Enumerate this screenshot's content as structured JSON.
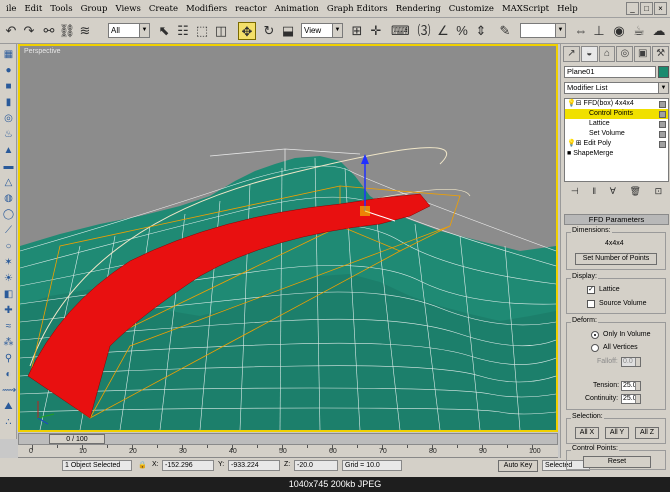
{
  "menu": [
    "ile",
    "Edit",
    "Tools",
    "Group",
    "Views",
    "Create",
    "Modifiers",
    "reactor",
    "Animation",
    "Graph Editors",
    "Rendering",
    "Customize",
    "MAXScript",
    "Help"
  ],
  "window_controls": [
    "_",
    "□",
    "×"
  ],
  "toolbar": {
    "selection_filter": "All",
    "reference_coord": "View"
  },
  "viewport": {
    "label": "Perspective",
    "colors": {
      "background": "#8c8c8c",
      "terrain": "#1f8a74",
      "wire": "#ffffff",
      "ribbon": "#e81010",
      "lattice": "#f0a000",
      "active_border": "#f0d000"
    }
  },
  "timeline": {
    "slider_label": "0 / 100",
    "ticks": [
      "0",
      "10",
      "20",
      "30",
      "40",
      "50",
      "60",
      "70",
      "80",
      "90",
      "100"
    ]
  },
  "status": {
    "selected": "1 Object Selected",
    "x_value": "-152.296",
    "y_value": "-933.224",
    "z_value": "-20.0",
    "grid": "Grid = 10.0",
    "autokey": "Auto Key",
    "selected_mode": "Selected"
  },
  "image_caption": "1040x745  200kb  JPEG",
  "panel": {
    "tabs": [
      "↗",
      "◒",
      "⌂",
      "◎",
      "▣",
      "⚒"
    ],
    "object_name": "Plane01",
    "modifier_list": "Modifier List",
    "stack": [
      {
        "label": "FFD(box) 4x4x4",
        "indent": 1,
        "selected": false
      },
      {
        "label": "Control Points",
        "indent": 2,
        "selected": true
      },
      {
        "label": "Lattice",
        "indent": 2,
        "selected": false
      },
      {
        "label": "Set Volume",
        "indent": 2,
        "selected": false
      },
      {
        "label": "Edit Poly",
        "indent": 1,
        "selected": false
      },
      {
        "label": "ShapeMerge",
        "indent": 0,
        "selected": false
      }
    ],
    "ffd": {
      "title": "FFD Parameters",
      "dimensions_label": "Dimensions:",
      "dimensions_value": "4x4x4",
      "set_points_button": "Set Number of Points",
      "display_label": "Display:",
      "lattice_label": "Lattice",
      "lattice_checked": true,
      "source_volume_label": "Source Volume",
      "source_volume_checked": false,
      "deform_label": "Deform:",
      "only_in_volume_label": "Only In Volume",
      "all_vertices_label": "All Vertices",
      "falloff_label": "Falloff:",
      "falloff_value": "0.0",
      "tension_label": "Tension:",
      "tension_value": "25.0",
      "continuity_label": "Continuity:",
      "continuity_value": "25.0",
      "selection_label": "Selection:",
      "all_x": "All X",
      "all_y": "All Y",
      "all_z": "All Z",
      "control_points_label": "Control Points:",
      "reset_button": "Reset"
    }
  }
}
